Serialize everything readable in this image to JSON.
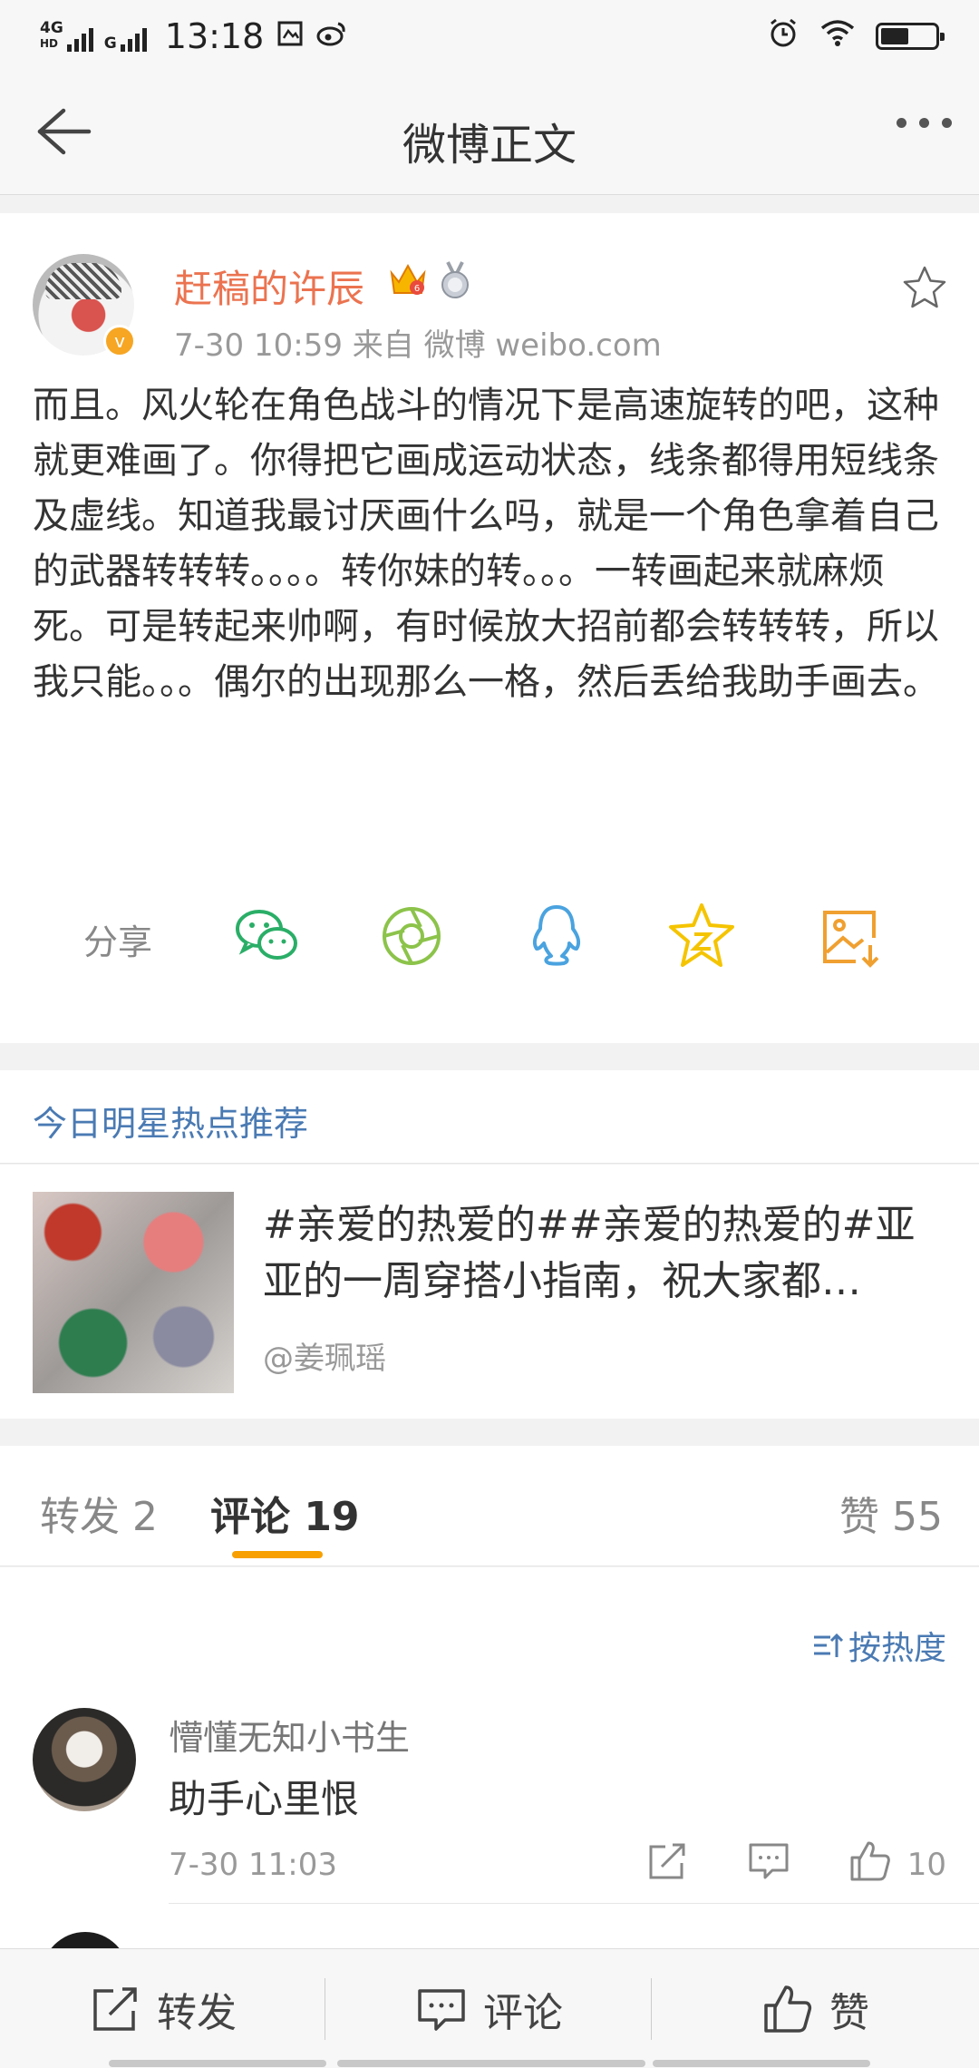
{
  "status_bar": {
    "network": "4G",
    "network_sub": "HD",
    "network2": "G",
    "time": "13:18"
  },
  "nav": {
    "title": "微博正文"
  },
  "post": {
    "author": "赶稿的许辰",
    "meta": "7-30 10:59   来自 微博 weibo.com",
    "body": "而且。风火轮在角色战斗的情况下是高速旋转的吧，这种就更难画了。你得把它画成运动状态，线条都得用短线条及虚线。知道我最讨厌画什么吗，就是一个角色拿着自己的武器转转转。。。。转你妹的转。。。一转画起来就麻烦死。可是转起来帅啊，有时候放大招前都会转转转，所以我只能。。。偶尔的出现那么一格，然后丢给我助手画去。",
    "share_label": "分享"
  },
  "hot": {
    "header": "今日明星热点推荐",
    "text": "#亲爱的热爱的##亲爱的热爱的#亚亚的一周穿搭小指南，祝大家都…",
    "source": "@姜珮瑶"
  },
  "tabs": {
    "repost": "转发 2",
    "comment": "评论 19",
    "like": "赞 55"
  },
  "comments": {
    "sort_label": "按热度",
    "items": [
      {
        "name": "懵懂无知小书生",
        "text": "助手心里恨",
        "time": "7-30 11:03",
        "likes": "10"
      }
    ]
  },
  "bottom_bar": {
    "repost": "转发",
    "comment": "评论",
    "like": "赞"
  },
  "colors": {
    "author_orange": "#eb7350",
    "link_blue": "#4a7ab3",
    "tab_indicator": "#f7a000",
    "wechat_green": "#2aae67",
    "moments_green": "#8cc34a",
    "qq_blue": "#4aa3df",
    "qzone_yellow": "#f5c400",
    "save_orange": "#f0a030"
  }
}
